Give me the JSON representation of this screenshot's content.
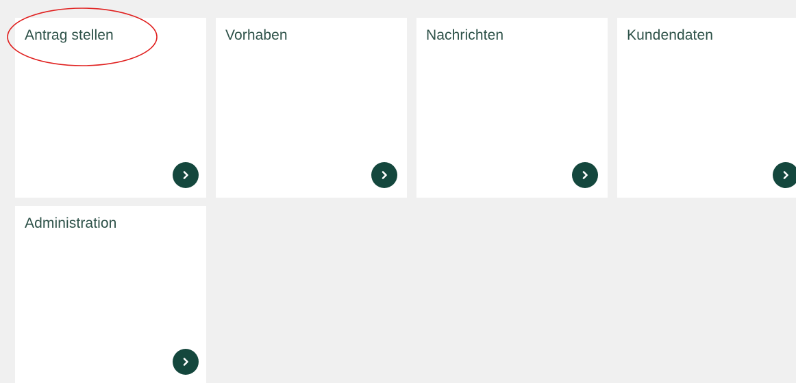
{
  "tiles": [
    {
      "id": "antrag-stellen",
      "label": "Antrag stellen",
      "icon": "chevron-right-icon"
    },
    {
      "id": "vorhaben",
      "label": "Vorhaben",
      "icon": "chevron-right-icon"
    },
    {
      "id": "nachrichten",
      "label": "Nachrichten",
      "icon": "chevron-right-icon"
    },
    {
      "id": "kundendaten",
      "label": "Kundendaten",
      "icon": "chevron-right-icon"
    },
    {
      "id": "administration",
      "label": "Administration",
      "icon": "chevron-right-icon"
    }
  ],
  "colors": {
    "background": "#f0f0f0",
    "tile": "#ffffff",
    "title_text": "#2d5148",
    "arrow_button": "#14473d",
    "annotation": "#e0201f"
  }
}
